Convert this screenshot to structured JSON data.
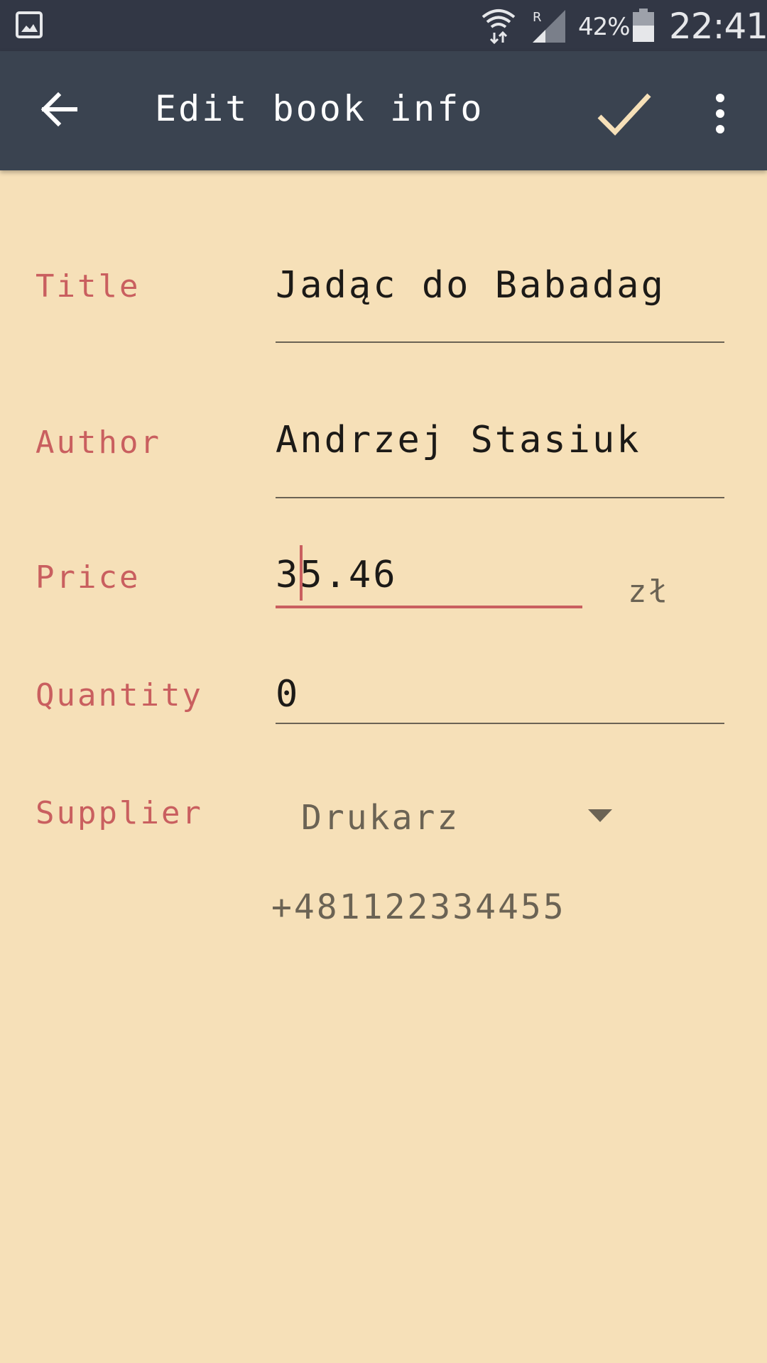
{
  "status_bar": {
    "battery_percent": "42%",
    "time": "22:41",
    "roaming_indicator": "R",
    "icons": [
      "gallery-icon",
      "wifi-icon",
      "signal-icon",
      "battery-icon"
    ]
  },
  "app_bar": {
    "title": "Edit book info",
    "icons": [
      "back-arrow-icon",
      "check-icon",
      "more-vert-icon"
    ],
    "colors": {
      "background": "#3a4350",
      "check": "#f6e0b8"
    }
  },
  "form": {
    "title": {
      "label": "Title",
      "value": "Jadąc do Babadag"
    },
    "author": {
      "label": "Author",
      "value": "Andrzej Stasiuk"
    },
    "price": {
      "label": "Price",
      "value": "35.46",
      "currency": "zł"
    },
    "quantity": {
      "label": "Quantity",
      "value": "0"
    },
    "supplier": {
      "label": "Supplier",
      "selected": "Drukarz",
      "phone": "+481122334455"
    }
  },
  "colors": {
    "background": "#f6e0b8",
    "label": "#c95f5f",
    "accent": "#c95f5f",
    "text": "#1c1a17",
    "secondary_text": "#6b6354"
  }
}
